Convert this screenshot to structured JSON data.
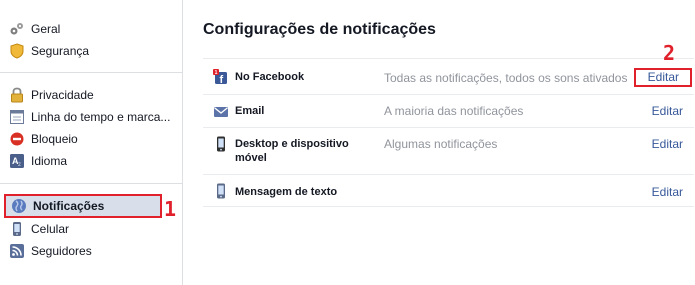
{
  "sidebar": {
    "group1": [
      {
        "label": "Geral",
        "icon": "gears-icon"
      },
      {
        "label": "Segurança",
        "icon": "shield-icon"
      }
    ],
    "group2": [
      {
        "label": "Privacidade",
        "icon": "lock-icon"
      },
      {
        "label": "Linha do tempo e marca...",
        "icon": "timeline-icon"
      },
      {
        "label": "Bloqueio",
        "icon": "block-icon"
      },
      {
        "label": "Idioma",
        "icon": "language-icon"
      }
    ],
    "group3": [
      {
        "label": "Notificações",
        "icon": "globe-icon",
        "active": true
      },
      {
        "label": "Celular",
        "icon": "mobile-icon"
      },
      {
        "label": "Seguidores",
        "icon": "rss-icon"
      }
    ]
  },
  "annotations": {
    "marker1": "1",
    "marker2": "2",
    "color": "#e0202b"
  },
  "main": {
    "title": "Configurações de notificações",
    "rows": [
      {
        "title": "No Facebook",
        "value": "Todas as notificações, todos os sons ativados",
        "edit": "Editar",
        "icon": "facebook-notification-icon"
      },
      {
        "title": "Email",
        "value": "A maioria das notificações",
        "edit": "Editar",
        "icon": "email-icon"
      },
      {
        "title": "Desktop e dispositivo móvel",
        "value": "Algumas notificações",
        "edit": "Editar",
        "icon": "phone-icon"
      },
      {
        "title": "Mensagem de texto",
        "value": "",
        "edit": "Editar",
        "icon": "sms-phone-icon"
      }
    ]
  },
  "colors": {
    "link": "#365899",
    "active_bg": "#d8dfea",
    "muted": "#90949c"
  }
}
